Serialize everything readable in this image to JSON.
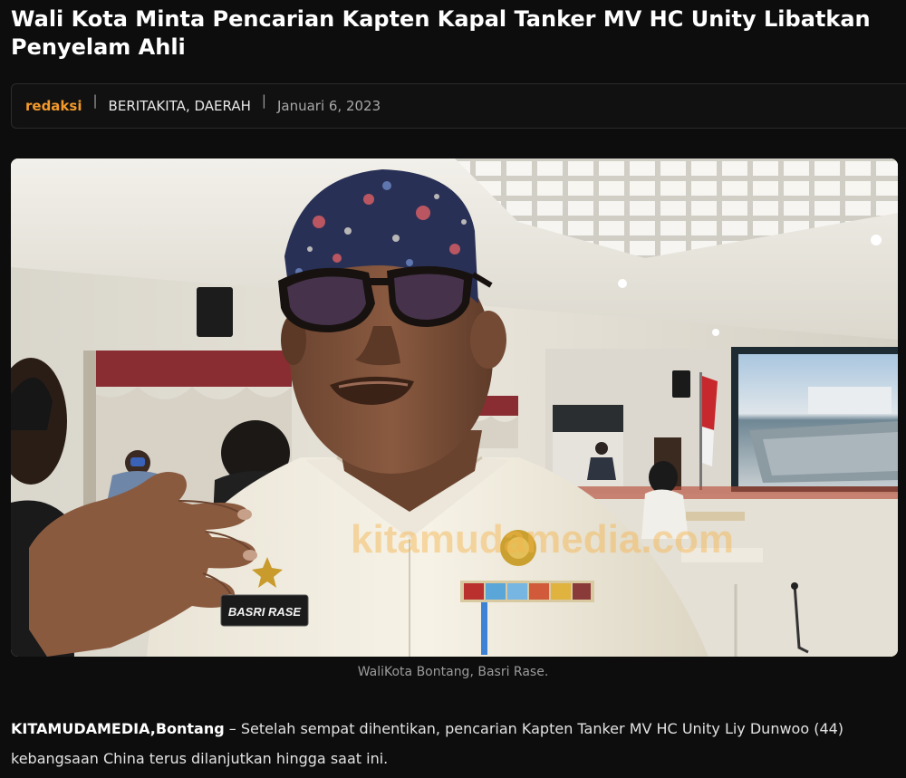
{
  "article": {
    "title": "Wali Kota Minta Pencarian Kapten Kapal Tanker MV HC Unity Libatkan Penyelam Ahli",
    "meta": {
      "author": "redaksi",
      "categories": [
        "BERITAKITA",
        "DAERAH"
      ],
      "category_separator": ", ",
      "date": "Januari 6, 2023"
    },
    "image": {
      "name_tag": "BASRI RASE",
      "watermark": "kitamudamedia.com"
    },
    "caption": "WaliKota Bontang, Basri Rase.",
    "lead": {
      "dateline": "KITAMUDAMEDIA,Bontang",
      "text": " – Setelah sempat dihentikan, pencarian Kapten Tanker MV HC Unity Liy Dunwoo (44) kebangsaan China terus dilanjutkan hingga saat ini."
    }
  },
  "colors": {
    "background": "#0d0d0d",
    "accent": "#f39a2b",
    "text": "#e2e2e2",
    "muted": "#9b9b9b"
  }
}
